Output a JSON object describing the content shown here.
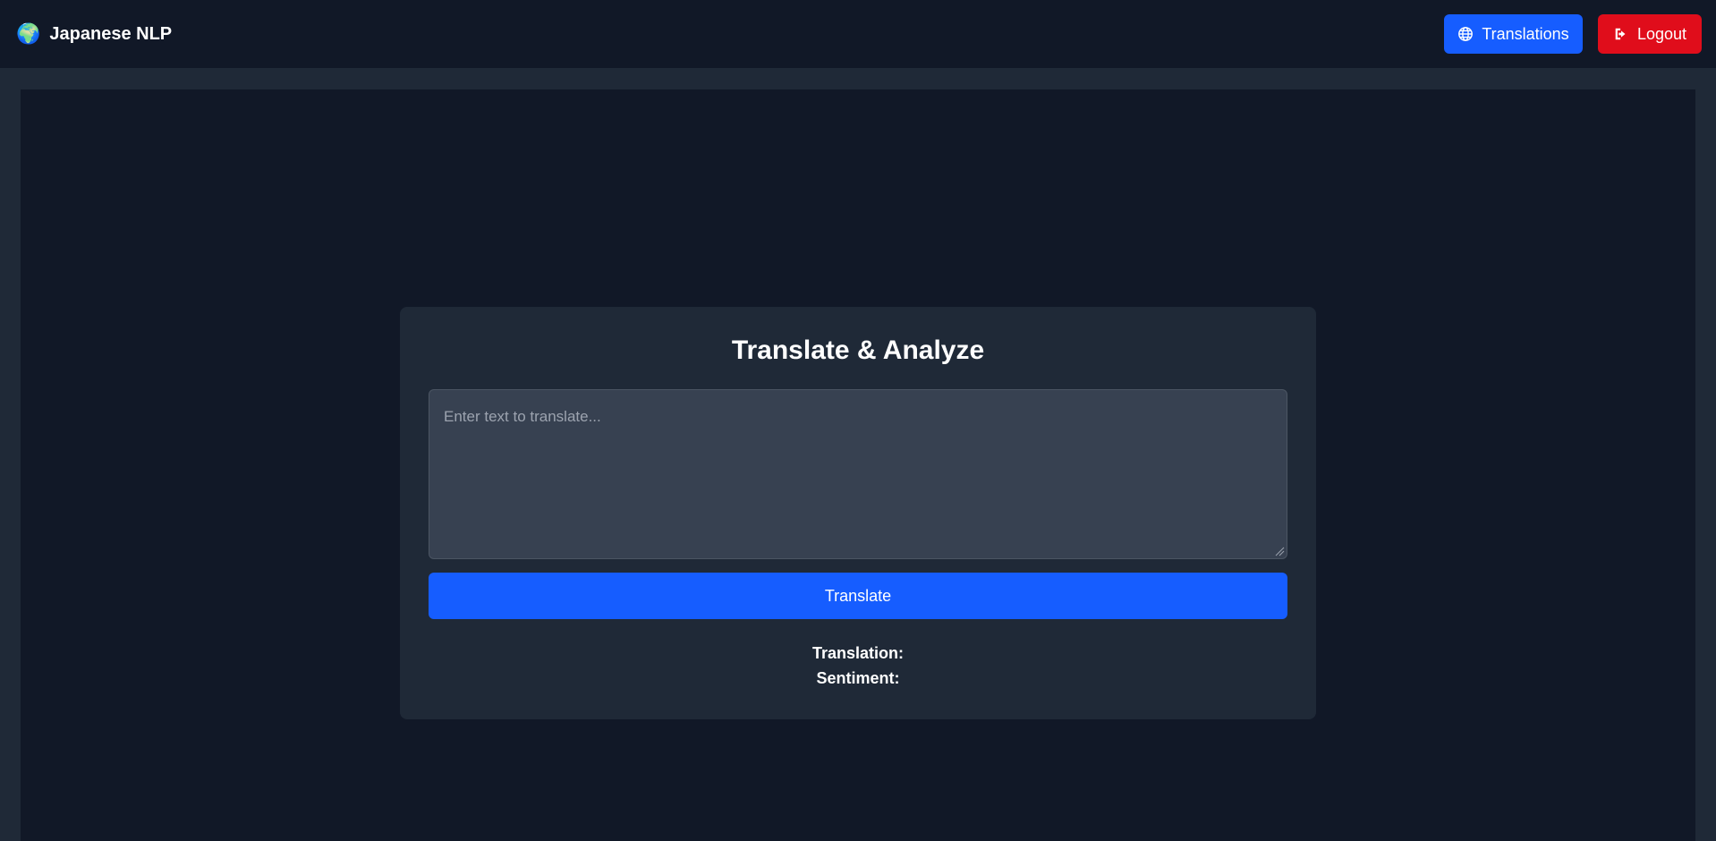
{
  "header": {
    "brand_icon": "globe-emoji-icon",
    "brand_title": "Japanese NLP",
    "translations_button": {
      "label": "Translations",
      "icon": "globe-icon",
      "color": "#165dff"
    },
    "logout_button": {
      "label": "Logout",
      "icon": "sign-out-icon",
      "color": "#e00d1b"
    }
  },
  "card": {
    "title": "Translate & Analyze",
    "input": {
      "placeholder": "Enter text to translate...",
      "value": ""
    },
    "translate_button": "Translate",
    "translation_label": "Translation:",
    "sentiment_label": "Sentiment:"
  },
  "colors": {
    "background": "#111827",
    "surface": "#1f2937",
    "input": "#374151",
    "primary": "#165dff",
    "danger": "#e00d1b"
  }
}
